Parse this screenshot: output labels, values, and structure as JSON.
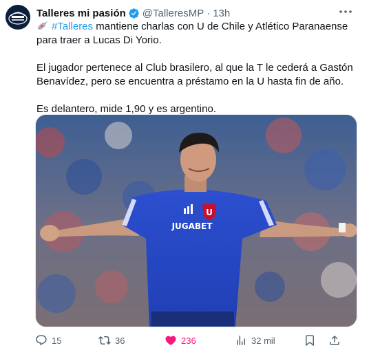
{
  "author": {
    "display_name": "Talleres mi pasión",
    "handle": "@TalleresMP",
    "separator": "·",
    "time": "13h"
  },
  "post": {
    "hashtag": "#Talleres",
    "line1_rest": " mantiene charlas con U de Chile y Atlético Paranaense para traer a Lucas Di Yorio.",
    "paragraph2": "El jugador pertenece al Club brasilero, al que la T le cederá a Gastón Benavídez, pero se encuentra a préstamo en la U hasta fin de año.",
    "paragraph3": "Es delantero, mide 1,90 y es argentino."
  },
  "image": {
    "kit_sponsor": "JUGABET"
  },
  "actions": {
    "replies": "15",
    "reposts": "36",
    "likes": "236",
    "views": "32 mil"
  },
  "colors": {
    "like_active": "#f91880",
    "link": "#1d9bf0",
    "verified": "#1d9bf0"
  },
  "icons": [
    "verified-icon",
    "more-icon",
    "syringe-icon",
    "reply-icon",
    "repost-icon",
    "heart-icon",
    "views-icon",
    "bookmark-icon",
    "share-icon"
  ]
}
